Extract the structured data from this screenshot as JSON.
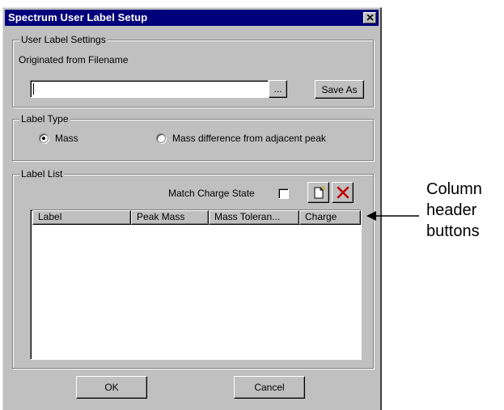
{
  "dialog": {
    "title": "Spectrum User Label Setup",
    "user_label_settings": {
      "legend": "User Label Settings",
      "filename_label": "Originated from Filename",
      "filename_value": "",
      "browse_label": "...",
      "save_as_label": "Save As"
    },
    "label_type": {
      "legend": "Label Type",
      "options": [
        {
          "label": "Mass",
          "selected": true
        },
        {
          "label": "Mass difference from adjacent peak",
          "selected": false
        }
      ]
    },
    "label_list": {
      "legend": "Label List",
      "match_charge_state_label": "Match Charge State",
      "match_charge_state_checked": false,
      "columns": [
        "Label",
        "Peak Mass",
        "Mass Toleran...",
        "Charge"
      ],
      "rows": []
    },
    "ok_label": "OK",
    "cancel_label": "Cancel"
  },
  "annotation": {
    "lines": [
      "Column",
      "header",
      "buttons"
    ]
  },
  "icons": {
    "close": "close-icon",
    "new_label": "new-document-icon",
    "delete_label": "delete-x-icon",
    "arrow": "arrow-left-icon"
  },
  "colors": {
    "titlebar": "#00007b",
    "dialog_face": "#c0c0c0",
    "delete_icon": "#c00000"
  }
}
